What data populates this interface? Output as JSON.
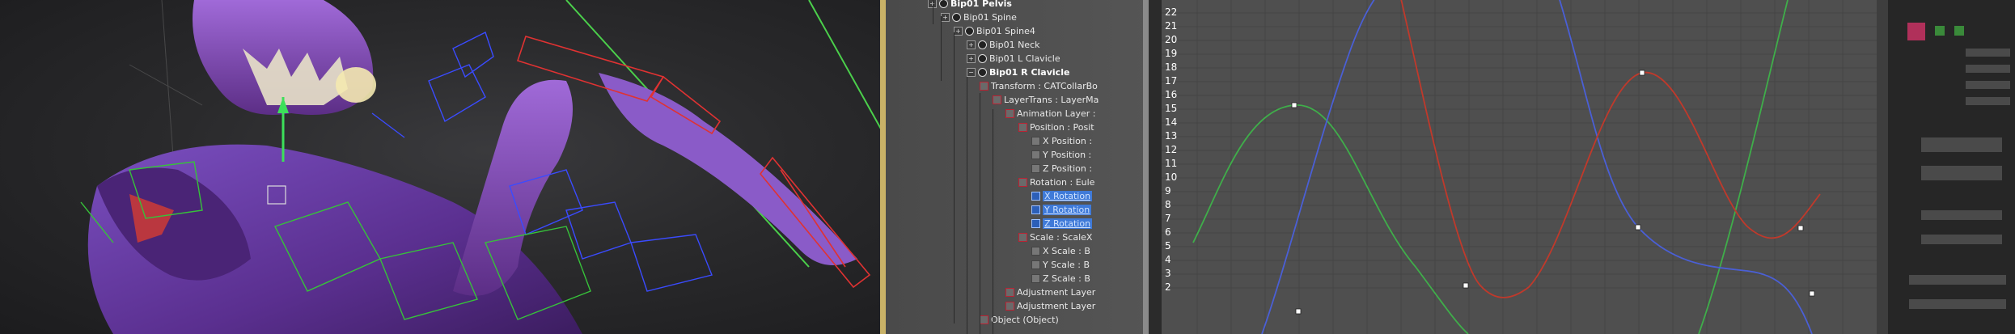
{
  "scene_tree": {
    "items": [
      {
        "label": "Bip01 Pelvis",
        "bold": true,
        "selected": false,
        "icon": "bone-icon",
        "indent": 0,
        "expander": "+"
      },
      {
        "label": "Bip01 Spine",
        "bold": false,
        "selected": false,
        "icon": "bone-icon",
        "indent": 1,
        "expander": "+"
      },
      {
        "label": "Bip01 Spine4",
        "bold": false,
        "selected": false,
        "icon": "bone-icon",
        "indent": 2,
        "expander": "+"
      },
      {
        "label": "Bip01 Neck",
        "bold": false,
        "selected": false,
        "icon": "bone-icon",
        "indent": 3,
        "expander": "+"
      },
      {
        "label": "Bip01 L Clavicle",
        "bold": false,
        "selected": false,
        "icon": "bone-icon",
        "indent": 3,
        "expander": "+"
      },
      {
        "label": "Bip01 R Clavicle",
        "bold": true,
        "selected": false,
        "icon": "bone-icon",
        "indent": 3,
        "expander": "−"
      },
      {
        "label": "Transform : CATCollarBo",
        "bold": false,
        "selected": false,
        "icon": "controller-icon",
        "indent": 4,
        "expander": ""
      },
      {
        "label": "LayerTrans : LayerMa",
        "bold": false,
        "selected": false,
        "icon": "controller-icon",
        "indent": 5,
        "expander": ""
      },
      {
        "label": "Animation Layer :",
        "bold": false,
        "selected": false,
        "icon": "controller-icon",
        "indent": 6,
        "expander": ""
      },
      {
        "label": "Position : Posit",
        "bold": false,
        "selected": false,
        "icon": "position-icon",
        "indent": 7,
        "expander": ""
      },
      {
        "label": "X Position :",
        "bold": false,
        "selected": false,
        "icon": "xyz-icon",
        "indent": 8,
        "expander": ""
      },
      {
        "label": "Y Position :",
        "bold": false,
        "selected": false,
        "icon": "xyz-icon",
        "indent": 8,
        "expander": ""
      },
      {
        "label": "Z Position :",
        "bold": false,
        "selected": false,
        "icon": "xyz-icon",
        "indent": 8,
        "expander": ""
      },
      {
        "label": "Rotation : Eule",
        "bold": false,
        "selected": false,
        "icon": "rotation-icon",
        "indent": 7,
        "expander": ""
      },
      {
        "label": "X Rotation",
        "bold": false,
        "selected": true,
        "icon": "xyz-icon",
        "indent": 8,
        "expander": ""
      },
      {
        "label": "Y Rotation",
        "bold": false,
        "selected": true,
        "icon": "xyz-icon",
        "indent": 8,
        "expander": ""
      },
      {
        "label": "Z Rotation",
        "bold": false,
        "selected": true,
        "icon": "xyz-icon",
        "indent": 8,
        "expander": ""
      },
      {
        "label": "Scale : ScaleX",
        "bold": false,
        "selected": false,
        "icon": "scale-icon",
        "indent": 7,
        "expander": ""
      },
      {
        "label": "X Scale : B",
        "bold": false,
        "selected": false,
        "icon": "xyz-icon",
        "indent": 8,
        "expander": ""
      },
      {
        "label": "Y Scale : B",
        "bold": false,
        "selected": false,
        "icon": "xyz-icon",
        "indent": 8,
        "expander": ""
      },
      {
        "label": "Z Scale : B",
        "bold": false,
        "selected": false,
        "icon": "xyz-icon",
        "indent": 8,
        "expander": ""
      },
      {
        "label": "Adjustment Layer",
        "bold": false,
        "selected": false,
        "icon": "controller-icon",
        "indent": 6,
        "expander": ""
      },
      {
        "label": "Adjustment Layer",
        "bold": false,
        "selected": false,
        "icon": "controller-icon",
        "indent": 6,
        "expander": ""
      },
      {
        "label": "Object (Object)",
        "bold": false,
        "selected": false,
        "icon": "object-icon",
        "indent": 4,
        "expander": ""
      }
    ]
  },
  "curve_editor": {
    "y_ticks": [
      "22",
      "21",
      "20",
      "19",
      "18",
      "17",
      "16",
      "15",
      "14",
      "13",
      "12",
      "11",
      "10",
      "9",
      "8",
      "7",
      "6",
      "5",
      "4",
      "3",
      "2"
    ],
    "colors": {
      "x_curve": "#c0392b",
      "y_curve": "#3fae4a",
      "z_curve": "#4a5fd6",
      "grid": "#444444",
      "background": "#4f4f4f"
    }
  },
  "viewport": {
    "colors": {
      "character": "#6b3fa8",
      "selection_red": "#e03232",
      "bones_blue": "#3a4bff",
      "bones_green": "#37c23a"
    }
  }
}
